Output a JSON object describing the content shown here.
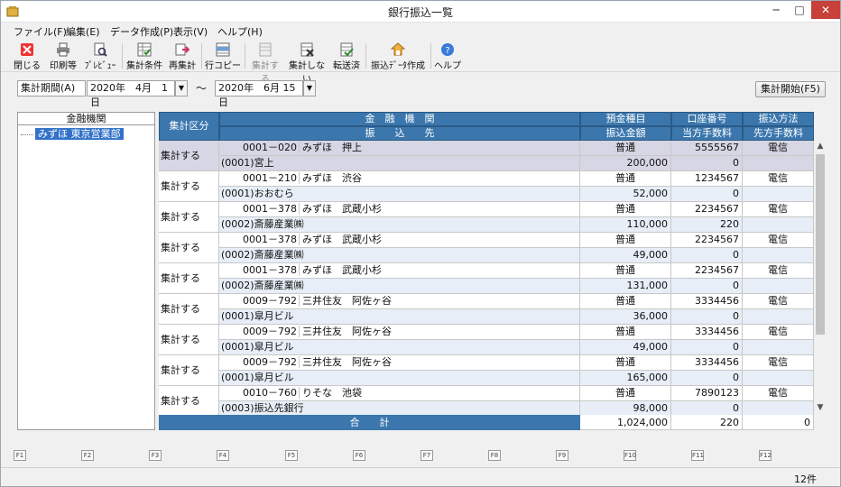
{
  "window": {
    "title": "銀行振込一覧",
    "minimize": "─",
    "maximize": "□",
    "close": "✕"
  },
  "menu": [
    "ファイル(F)",
    "編集(E)",
    "データ作成(P)",
    "表示(V)",
    "ヘルプ(H)"
  ],
  "toolbar": [
    {
      "label": "閉じる",
      "icon": "close-icon",
      "disabled": false
    },
    {
      "label": "印刷等",
      "icon": "printer-icon",
      "disabled": false
    },
    {
      "label": "ﾌﾟﾚﾋﾞｭｰ",
      "icon": "preview-icon",
      "disabled": false
    },
    {
      "label": "集計条件",
      "icon": "conditions-icon",
      "disabled": false
    },
    {
      "label": "再集計",
      "icon": "recalc-icon",
      "disabled": false
    },
    {
      "label": "行コピー",
      "icon": "row-copy-icon",
      "disabled": false
    },
    {
      "label": "集計する",
      "icon": "include-icon",
      "disabled": true
    },
    {
      "label": "集計しない",
      "icon": "exclude-icon",
      "disabled": false
    },
    {
      "label": "転送済",
      "icon": "transferred-icon",
      "disabled": false
    },
    {
      "label": "振込ﾃﾞｰﾀ作成",
      "icon": "create-data-icon",
      "disabled": false
    },
    {
      "label": "ヘルプ",
      "icon": "help-icon",
      "disabled": false
    }
  ],
  "period": {
    "label": "集計期間(A)",
    "from": "2020年　4月　1日",
    "tilde": "～",
    "to": "2020年　6月 15日",
    "start_button": "集計開始(F5)"
  },
  "tree": {
    "header": "金融機関",
    "items": [
      "みずほ 東京営業部"
    ]
  },
  "grid": {
    "headers": {
      "kubun": "集計区分",
      "kikan": "金　融　機　関",
      "saki": "振　　込　　先",
      "shumoku": "預金種目",
      "kingaku": "振込金額",
      "koza": "口座番号",
      "tohou": "当方手数料",
      "houhou": "振込方法",
      "senpou": "先方手数料"
    },
    "rows": [
      {
        "kubun": "集計する",
        "code": "0001－020",
        "bank": "みずほ　押上",
        "payee": "(0001)宮上",
        "type": "普通",
        "amount": "200,000",
        "account": "5555567",
        "fee_ours": "0",
        "method": "電信",
        "fee_theirs": ""
      },
      {
        "kubun": "集計する",
        "code": "0001－210",
        "bank": "みずほ　渋谷",
        "payee": "(0001)おおむら",
        "type": "普通",
        "amount": "52,000",
        "account": "1234567",
        "fee_ours": "0",
        "method": "電信",
        "fee_theirs": ""
      },
      {
        "kubun": "集計する",
        "code": "0001－378",
        "bank": "みずほ　武蔵小杉",
        "payee": "(0002)斎藤産業㈱",
        "type": "普通",
        "amount": "110,000",
        "account": "2234567",
        "fee_ours": "220",
        "method": "電信",
        "fee_theirs": ""
      },
      {
        "kubun": "集計する",
        "code": "0001－378",
        "bank": "みずほ　武蔵小杉",
        "payee": "(0002)斎藤産業㈱",
        "type": "普通",
        "amount": "49,000",
        "account": "2234567",
        "fee_ours": "0",
        "method": "電信",
        "fee_theirs": ""
      },
      {
        "kubun": "集計する",
        "code": "0001－378",
        "bank": "みずほ　武蔵小杉",
        "payee": "(0002)斎藤産業㈱",
        "type": "普通",
        "amount": "131,000",
        "account": "2234567",
        "fee_ours": "0",
        "method": "電信",
        "fee_theirs": ""
      },
      {
        "kubun": "集計する",
        "code": "0009－792",
        "bank": "三井住友　阿佐ヶ谷",
        "payee": "(0001)皐月ビル",
        "type": "普通",
        "amount": "36,000",
        "account": "3334456",
        "fee_ours": "0",
        "method": "電信",
        "fee_theirs": ""
      },
      {
        "kubun": "集計する",
        "code": "0009－792",
        "bank": "三井住友　阿佐ヶ谷",
        "payee": "(0001)皐月ビル",
        "type": "普通",
        "amount": "49,000",
        "account": "3334456",
        "fee_ours": "0",
        "method": "電信",
        "fee_theirs": ""
      },
      {
        "kubun": "集計する",
        "code": "0009－792",
        "bank": "三井住友　阿佐ヶ谷",
        "payee": "(0001)皐月ビル",
        "type": "普通",
        "amount": "165,000",
        "account": "3334456",
        "fee_ours": "0",
        "method": "電信",
        "fee_theirs": ""
      },
      {
        "kubun": "集計する",
        "code": "0010－760",
        "bank": "りそな　池袋",
        "payee": "(0003)振込先銀行",
        "type": "普通",
        "amount": "98,000",
        "account": "7890123",
        "fee_ours": "0",
        "method": "電信",
        "fee_theirs": ""
      }
    ],
    "total": {
      "label": "合　　計",
      "amount": "1,024,000",
      "fee_ours": "220",
      "fee_theirs": "0"
    }
  },
  "fkeys": [
    "F1",
    "F2",
    "F3",
    "F4",
    "F5",
    "F6",
    "F7",
    "F8",
    "F9",
    "F10",
    "F11",
    "F12"
  ],
  "status": {
    "count": "12件"
  },
  "colors": {
    "header_bg": "#3b77ad",
    "selected_row": "#d6d6e4",
    "alt_row": "#e7eef7"
  }
}
